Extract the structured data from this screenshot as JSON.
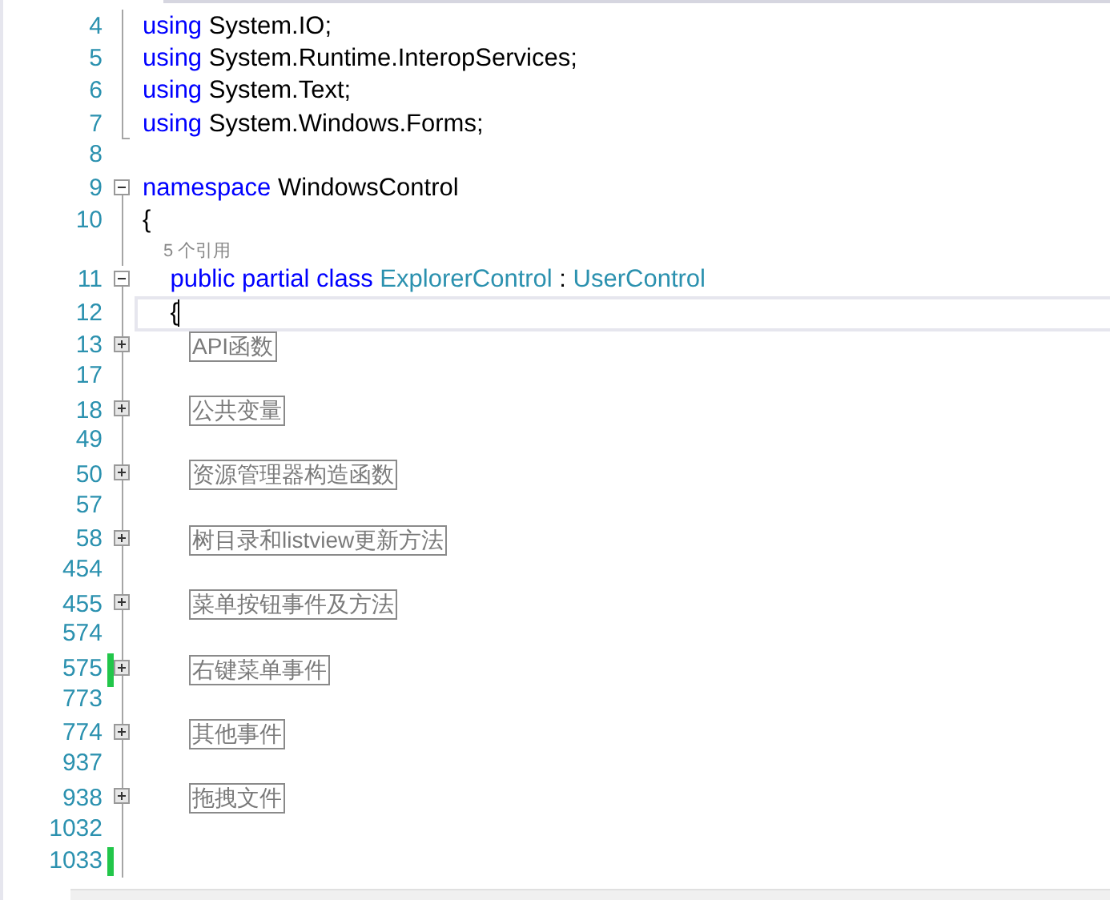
{
  "editor": {
    "rows": [
      {
        "kind": "code",
        "number": "4",
        "guide": true,
        "tokens": [
          {
            "kind": "keyword",
            "text": "using"
          },
          {
            "kind": "plain",
            "text": " System.IO;"
          }
        ]
      },
      {
        "kind": "code",
        "number": "5",
        "guide": true,
        "tokens": [
          {
            "kind": "keyword",
            "text": "using"
          },
          {
            "kind": "plain",
            "text": " System.Runtime.InteropServices;"
          }
        ]
      },
      {
        "kind": "code",
        "number": "6",
        "guide": true,
        "tokens": [
          {
            "kind": "keyword",
            "text": "using"
          },
          {
            "kind": "plain",
            "text": " System.Text;"
          }
        ]
      },
      {
        "kind": "code",
        "number": "7",
        "guide": true,
        "guide_end": true,
        "tokens": [
          {
            "kind": "keyword",
            "text": "using"
          },
          {
            "kind": "plain",
            "text": " System.Windows.Forms;"
          }
        ]
      },
      {
        "kind": "code",
        "number": "8"
      },
      {
        "kind": "code",
        "number": "9",
        "expanded": true,
        "tokens": [
          {
            "kind": "keyword",
            "text": "namespace"
          },
          {
            "kind": "plain",
            "text": " WindowsControl"
          }
        ]
      },
      {
        "kind": "code",
        "number": "10",
        "guide": true,
        "tokens": [
          {
            "kind": "plain",
            "text": "{"
          }
        ]
      },
      {
        "kind": "codelens",
        "guide": true,
        "text": "5 个引用"
      },
      {
        "kind": "code",
        "number": "11",
        "expanded": true,
        "tokens": [
          {
            "kind": "keyword",
            "text": "    public partial class"
          },
          {
            "kind": "type",
            "text": " ExplorerControl"
          },
          {
            "kind": "plain",
            "text": " : "
          },
          {
            "kind": "type",
            "text": "UserControl"
          }
        ]
      },
      {
        "kind": "code",
        "number": "12",
        "guide": true,
        "current": true,
        "tokens": [
          {
            "kind": "plain",
            "text": "    {"
          }
        ]
      },
      {
        "kind": "region",
        "number": "13",
        "expanded": false,
        "guide": true,
        "text": "API函数"
      },
      {
        "kind": "code",
        "number": "17",
        "guide": true
      },
      {
        "kind": "region",
        "number": "18",
        "expanded": false,
        "guide": true,
        "text": "公共变量"
      },
      {
        "kind": "code",
        "number": "49",
        "guide": true
      },
      {
        "kind": "region",
        "number": "50",
        "expanded": false,
        "guide": true,
        "text": "资源管理器构造函数"
      },
      {
        "kind": "code",
        "number": "57",
        "guide": true
      },
      {
        "kind": "region",
        "number": "58",
        "expanded": false,
        "guide": true,
        "text": "树目录和listview更新方法"
      },
      {
        "kind": "code",
        "number": "454",
        "guide": true
      },
      {
        "kind": "region",
        "number": "455",
        "expanded": false,
        "guide": true,
        "text": "菜单按钮事件及方法"
      },
      {
        "kind": "code",
        "number": "574",
        "guide": true
      },
      {
        "kind": "region",
        "number": "575",
        "expanded": false,
        "guide": true,
        "changed": true,
        "text": "右键菜单事件"
      },
      {
        "kind": "code",
        "number": "773",
        "guide": true
      },
      {
        "kind": "region",
        "number": "774",
        "expanded": false,
        "guide": true,
        "text": "其他事件"
      },
      {
        "kind": "code",
        "number": "937",
        "guide": true
      },
      {
        "kind": "region",
        "number": "938",
        "expanded": false,
        "guide": true,
        "text": "拖拽文件"
      },
      {
        "kind": "code",
        "number": "1032",
        "guide": true
      },
      {
        "kind": "code",
        "number": "1033",
        "guide": true,
        "changed": true
      }
    ]
  }
}
